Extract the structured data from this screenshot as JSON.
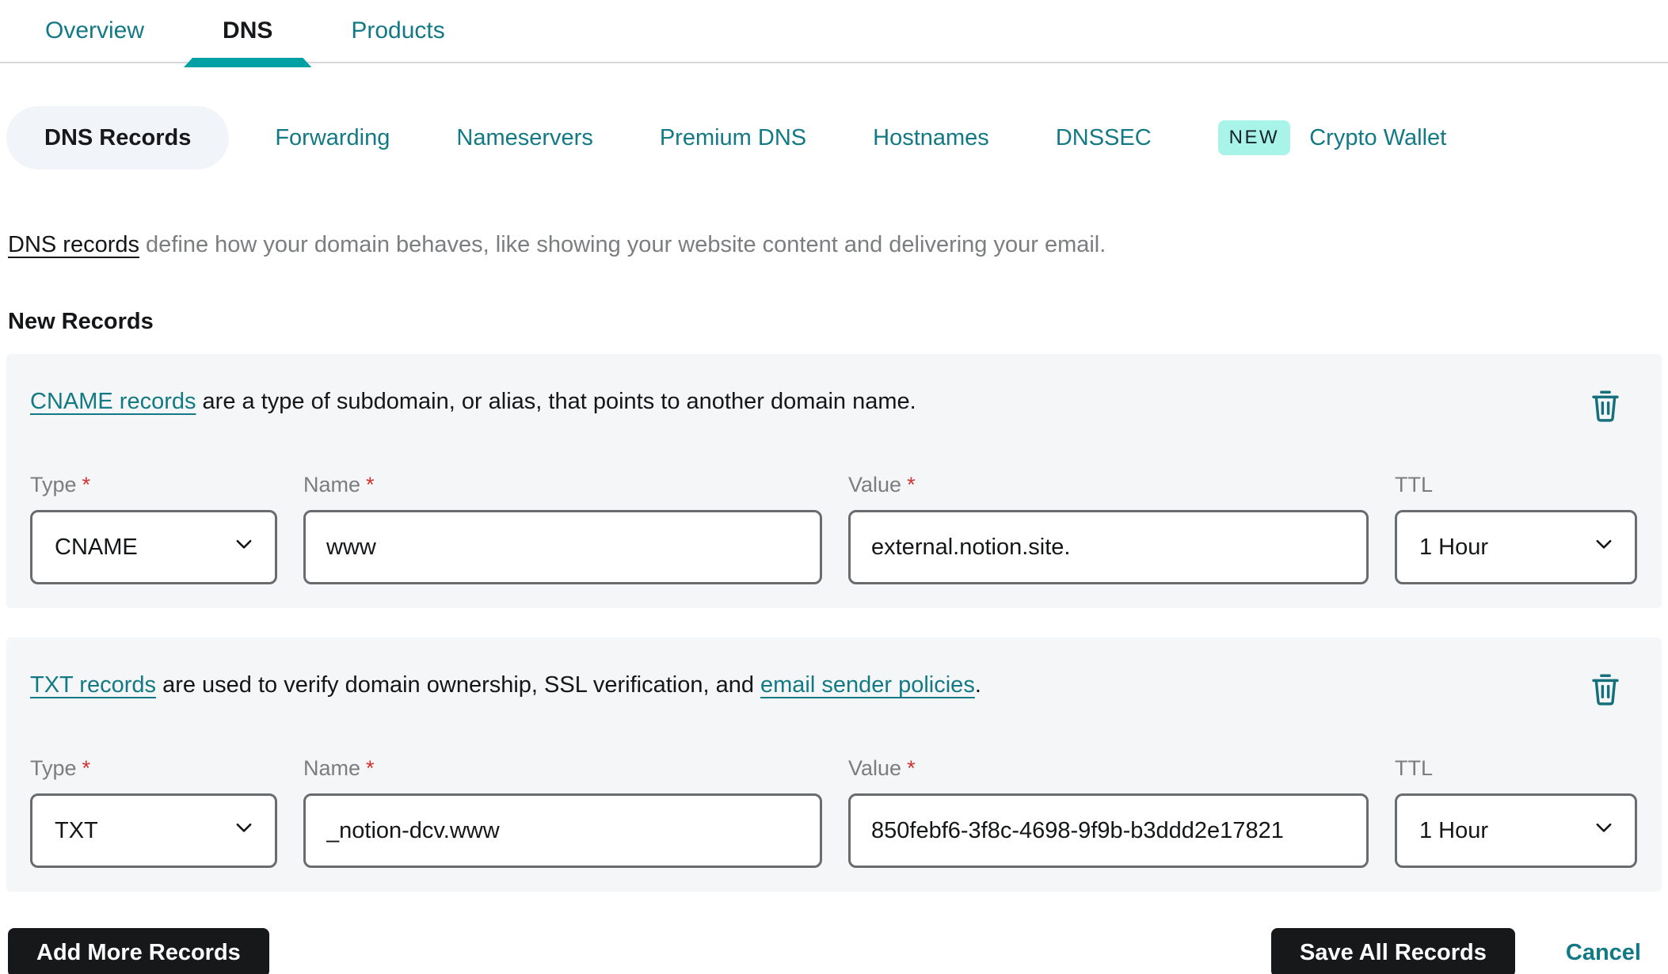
{
  "colors": {
    "accent_teal": "#137a85",
    "active_tab_underline": "#00a0a5",
    "new_badge_bg": "#a8f4e8",
    "card_bg": "#f4f6f7",
    "active_pill_bg": "#f1f4f9",
    "button_bg": "#17181a",
    "required_red": "#d0342c"
  },
  "tabs": [
    {
      "label": "Overview",
      "active": false
    },
    {
      "label": "DNS",
      "active": true
    },
    {
      "label": "Products",
      "active": false
    }
  ],
  "subtabs": {
    "items": [
      {
        "label": "DNS Records",
        "active": true
      },
      {
        "label": "Forwarding"
      },
      {
        "label": "Nameservers"
      },
      {
        "label": "Premium DNS"
      },
      {
        "label": "Hostnames"
      },
      {
        "label": "DNSSEC"
      },
      {
        "label": "Crypto Wallet",
        "badge": "NEW"
      }
    ]
  },
  "intro": {
    "link": "DNS records",
    "text": " define how your domain behaves, like showing your website content and delivering your email."
  },
  "section_heading": "New Records",
  "records": [
    {
      "intro": {
        "link": "CNAME records",
        "after": " are a type of subdomain, or alias, that points to another domain name."
      },
      "fields": {
        "type": {
          "label": "Type",
          "required": "*",
          "value": "CNAME"
        },
        "name": {
          "label": "Name",
          "required": "*",
          "value": "www"
        },
        "value": {
          "label": "Value",
          "required": "*",
          "value": "external.notion.site."
        },
        "ttl": {
          "label": "TTL",
          "value": "1 Hour"
        }
      }
    },
    {
      "intro": {
        "link": "TXT records",
        "middle": " are used to verify domain ownership, SSL verification, and ",
        "link2": "email sender policies",
        "after": "."
      },
      "fields": {
        "type": {
          "label": "Type",
          "required": "*",
          "value": "TXT"
        },
        "name": {
          "label": "Name",
          "required": "*",
          "value": "_notion-dcv.www"
        },
        "value": {
          "label": "Value",
          "required": "*",
          "value": "850febf6-3f8c-4698-9f9b-b3ddd2e17821"
        },
        "ttl": {
          "label": "TTL",
          "value": "1 Hour"
        }
      }
    }
  ],
  "footer": {
    "add_button": "Add More Records",
    "save_button": "Save All Records",
    "cancel_link": "Cancel"
  }
}
